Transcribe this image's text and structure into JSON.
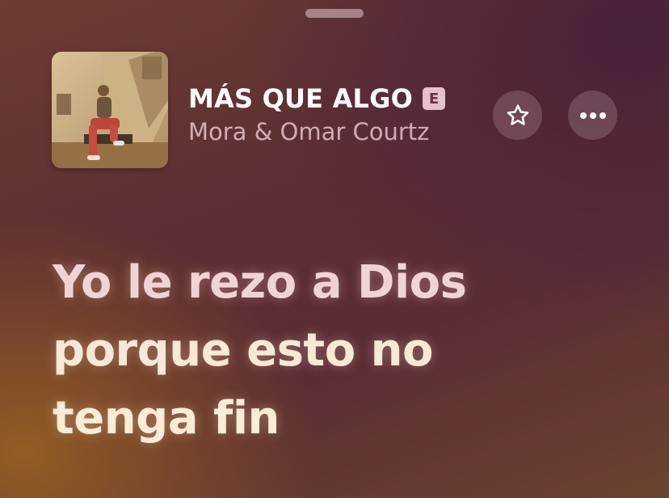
{
  "now_playing": {
    "title": "MÁS QUE ALGO",
    "explicit_badge": "E",
    "artist": "Mora & Omar Courtz",
    "artwork_icon": "album-artwork"
  },
  "actions": {
    "favorite_icon": "star-icon",
    "more_icon": "ellipsis-icon"
  },
  "lyrics": {
    "lines": [
      "Yo le rezo a Dios",
      "porque esto no",
      "tenga fin"
    ]
  },
  "colors": {
    "background_warm": "#965f23",
    "background_dark": "#48203a",
    "lyric_text": "#f7dfe2"
  }
}
